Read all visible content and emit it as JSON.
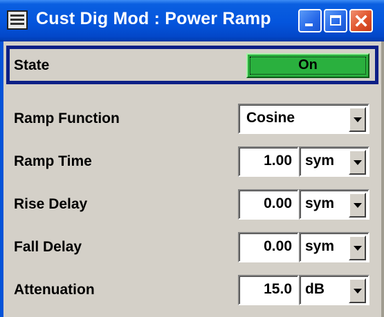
{
  "window": {
    "title": "Cust Dig Mod : Power Ramp",
    "icon": "keyboard-icon",
    "controls": [
      "minimize-icon",
      "maximize-icon",
      "close-icon"
    ],
    "close_glyph": "✕"
  },
  "state": {
    "label": "State",
    "value": "On",
    "color": "#2ab03e"
  },
  "ramp_function": {
    "label": "Ramp Function",
    "value": "Cosine"
  },
  "ramp_time": {
    "label": "Ramp Time",
    "value": "1.00",
    "unit": "sym"
  },
  "rise_delay": {
    "label": "Rise Delay",
    "value": "0.00",
    "unit": "sym"
  },
  "fall_delay": {
    "label": "Fall Delay",
    "value": "0.00",
    "unit": "sym"
  },
  "attenuation": {
    "label": "Attenuation",
    "value": "15.0",
    "unit": "dB"
  }
}
